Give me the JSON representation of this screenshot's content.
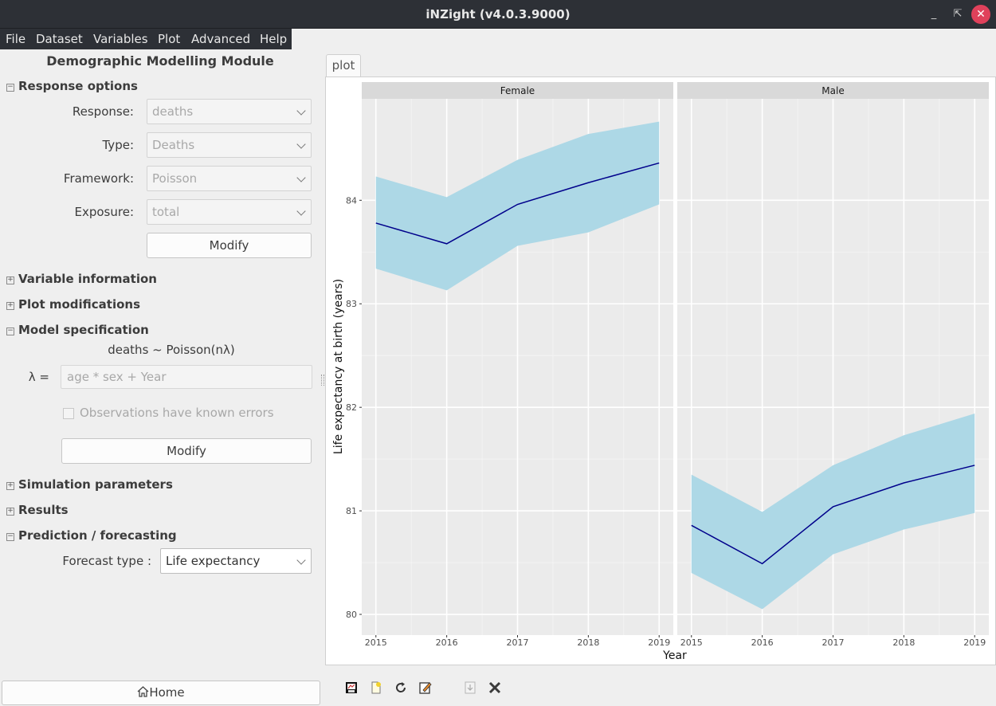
{
  "window": {
    "title": "iNZight (v4.0.3.9000)",
    "controls": {
      "minimize": "_",
      "maximize": "⇱",
      "close": "✕"
    }
  },
  "menu": {
    "items": [
      "File",
      "Dataset",
      "Variables",
      "Plot",
      "Advanced",
      "Help"
    ]
  },
  "panel": {
    "title": "Demographic Modelling Module",
    "response_section": "Response options",
    "response_label": "Response:",
    "response_value": "deaths",
    "type_label": "Type:",
    "type_value": "Deaths",
    "framework_label": "Framework:",
    "framework_value": "Poisson",
    "exposure_label": "Exposure:",
    "exposure_value": "total",
    "modify_label": "Modify",
    "variable_info_section": "Variable information",
    "plot_mod_section": "Plot modifications",
    "model_spec_section": "Model specification",
    "formula": "deaths ~ Poisson(nλ)",
    "lambda_label": "λ =",
    "lambda_placeholder": "age * sex + Year",
    "known_errors_label": "Observations have known errors",
    "modify2_label": "Modify",
    "simulation_section": "Simulation parameters",
    "results_section": "Results",
    "prediction_section": "Prediction / forecasting",
    "forecast_label": "Forecast type :",
    "forecast_value": "Life expectancy",
    "home_label": "Home"
  },
  "plot_tab": "plot",
  "colors": {
    "titlebar": "#2d3036",
    "ribbon": "#add8e6",
    "line": "#00008b",
    "panel_bg": "#ebebeb",
    "strip_bg": "#d9d9d9",
    "close_btn": "#e0415b"
  },
  "toolbar_icons": [
    "export-plot-icon",
    "new-plot-icon",
    "refresh-icon",
    "edit-icon",
    "download-icon",
    "close-plot-icon"
  ],
  "chart_data": {
    "type": "line",
    "ylabel": "Life expectancy at birth (years)",
    "xlabel": "Year",
    "x": [
      2015,
      2016,
      2017,
      2018,
      2019
    ],
    "x_ticks": [
      "2015",
      "2016",
      "2017",
      "2018",
      "2019"
    ],
    "y_ticks": [
      "80",
      "81",
      "82",
      "83",
      "84"
    ],
    "ylim": [
      79.8,
      84.98
    ],
    "xlim": [
      2014.8,
      2019.2
    ],
    "grid": true,
    "panels": [
      {
        "strip": "Female",
        "mean": [
          83.78,
          83.58,
          83.96,
          84.17,
          84.36
        ],
        "lower": [
          83.34,
          83.13,
          83.56,
          83.69,
          83.96
        ],
        "upper": [
          84.23,
          84.03,
          84.39,
          84.64,
          84.76
        ]
      },
      {
        "strip": "Male",
        "mean": [
          80.86,
          80.49,
          81.04,
          81.27,
          81.44
        ],
        "lower": [
          80.4,
          80.05,
          80.58,
          80.82,
          80.98
        ],
        "upper": [
          81.35,
          80.99,
          81.44,
          81.73,
          81.94
        ]
      }
    ]
  }
}
